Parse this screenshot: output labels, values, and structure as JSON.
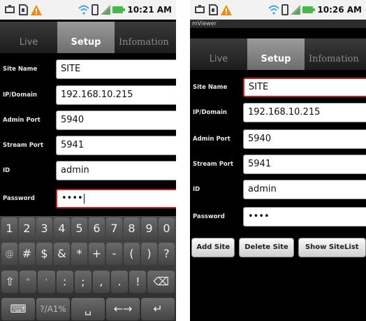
{
  "left": {
    "status_time": "10:21 AM",
    "tabs": [
      "Live",
      "Setup",
      "Infomation"
    ],
    "fields": [
      {
        "label": "Site Name",
        "value": "SITE"
      },
      {
        "label": "IP/Domain",
        "value": "192.168.10.215"
      },
      {
        "label": "Admin Port",
        "value": "5940"
      },
      {
        "label": "Stream Port",
        "value": "5941"
      },
      {
        "label": "ID",
        "value": "admin"
      },
      {
        "label": "Password",
        "value": "••••"
      }
    ],
    "keyboard": {
      "row1": [
        "1",
        "2",
        "3",
        "4",
        "5",
        "6",
        "7",
        "8",
        "9",
        "0"
      ],
      "row2": [
        "@",
        "#",
        "$",
        "&",
        "*",
        "+",
        "-",
        "(",
        ")",
        "?"
      ],
      "row3": [
        "⇧",
        "\"",
        "'",
        ":",
        ";",
        ",",
        ".",
        "!",
        "⌫"
      ],
      "row4": [
        "⌨",
        "?/A1%",
        "␣",
        "←→",
        "↵"
      ]
    }
  },
  "right": {
    "status_time": "10:26 AM",
    "app_title": "mViewer",
    "tabs": [
      "Live",
      "Setup",
      "Infomation"
    ],
    "fields": [
      {
        "label": "Site Name",
        "value": "SITE"
      },
      {
        "label": "IP/Domain",
        "value": "192.168.10.215"
      },
      {
        "label": "Admin Port",
        "value": "5940"
      },
      {
        "label": "Stream Port",
        "value": "5941"
      },
      {
        "label": "ID",
        "value": "admin"
      },
      {
        "label": "Password",
        "value": "••••"
      }
    ],
    "buttons": {
      "add": "Add Site",
      "delete": "Delete Site",
      "show": "Show SiteList"
    }
  },
  "colors": {
    "focus_border": "#c92020",
    "active_tab": "#8a8a8a",
    "background": "#000000"
  },
  "icons": [
    "usb-icon",
    "sd-card-icon",
    "warning-icon",
    "wifi-icon",
    "vibrate-icon",
    "signal-icon",
    "battery-icon"
  ]
}
